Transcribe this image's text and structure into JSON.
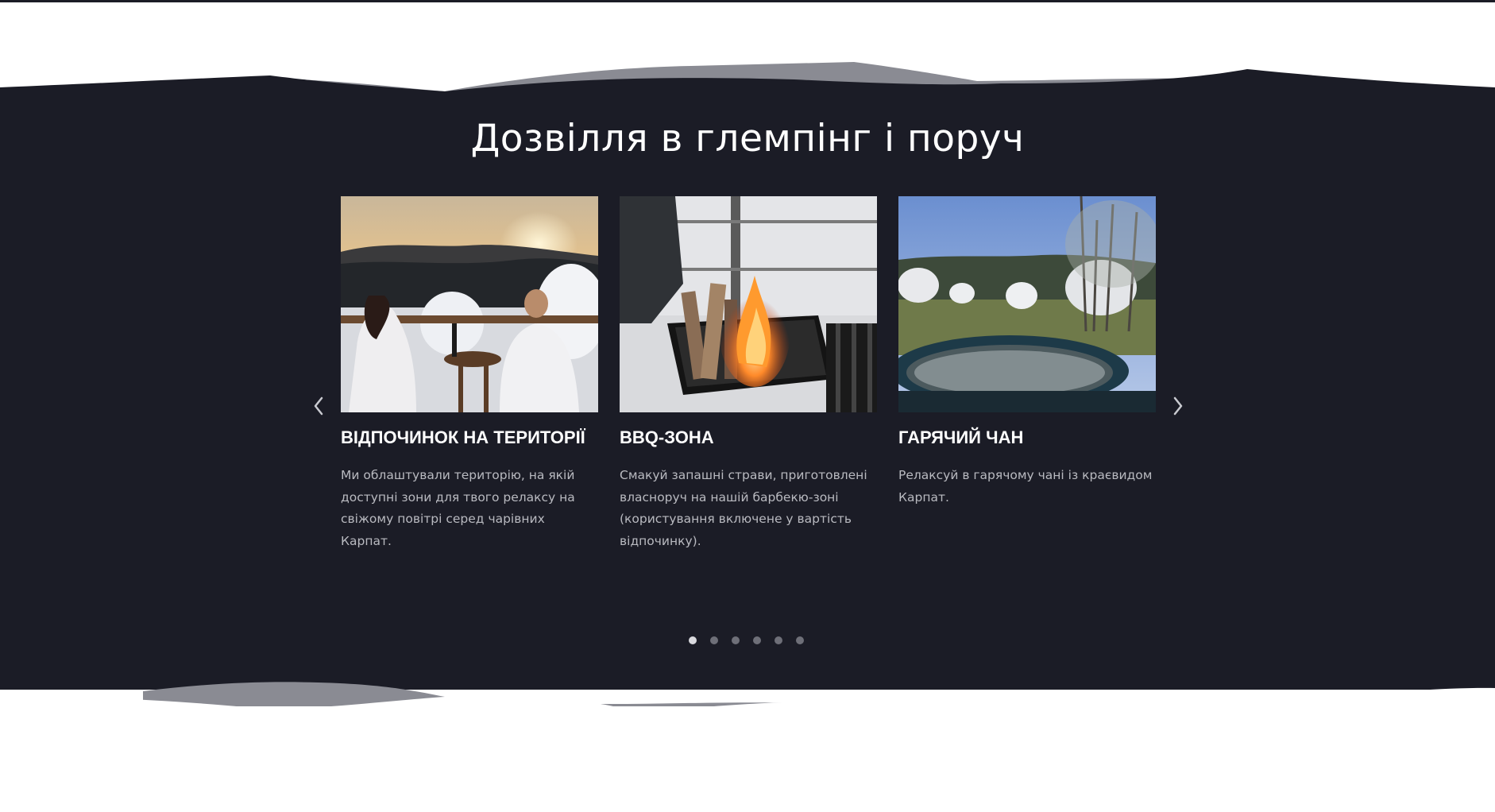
{
  "section": {
    "title": "Дозвілля в глемпінг і поруч"
  },
  "colors": {
    "background_dark": "#1b1c26",
    "wave_gray": "#8a8b93",
    "title_text": "#ffffff",
    "body_text": "#b9bac0",
    "dot_active": "#d9d9de",
    "dot_inactive": "#6e6f78"
  },
  "carousel": {
    "prev_icon": "chevron-left-icon",
    "next_icon": "chevron-right-icon",
    "active_dot_index": 0,
    "dot_count": 6,
    "cards": [
      {
        "image": "couple-on-terrace-sunset-photo",
        "title": "ВІДПОЧИНОК НА ТЕРИТОРІЇ",
        "lines": [
          "Ми облаштували територію, на якій",
          "доступні зони для твого релаксу на",
          "свіжому повітрі серед чарівних Карпат."
        ]
      },
      {
        "image": "bbq-fire-grill-photo",
        "title": "BBQ-ЗОНА",
        "lines": [
          "Смакуй запашні страви, приготовлені",
          "власноруч на нашій барбекю-зоні",
          "(користування включене у вартість",
          "відпочинку)."
        ]
      },
      {
        "image": "hot-tub-domes-photo",
        "title": "ГАРЯЧИЙ ЧАН",
        "lines": [
          "Релаксуй в гарячому чані із краєвидом",
          "Карпат."
        ]
      }
    ]
  }
}
